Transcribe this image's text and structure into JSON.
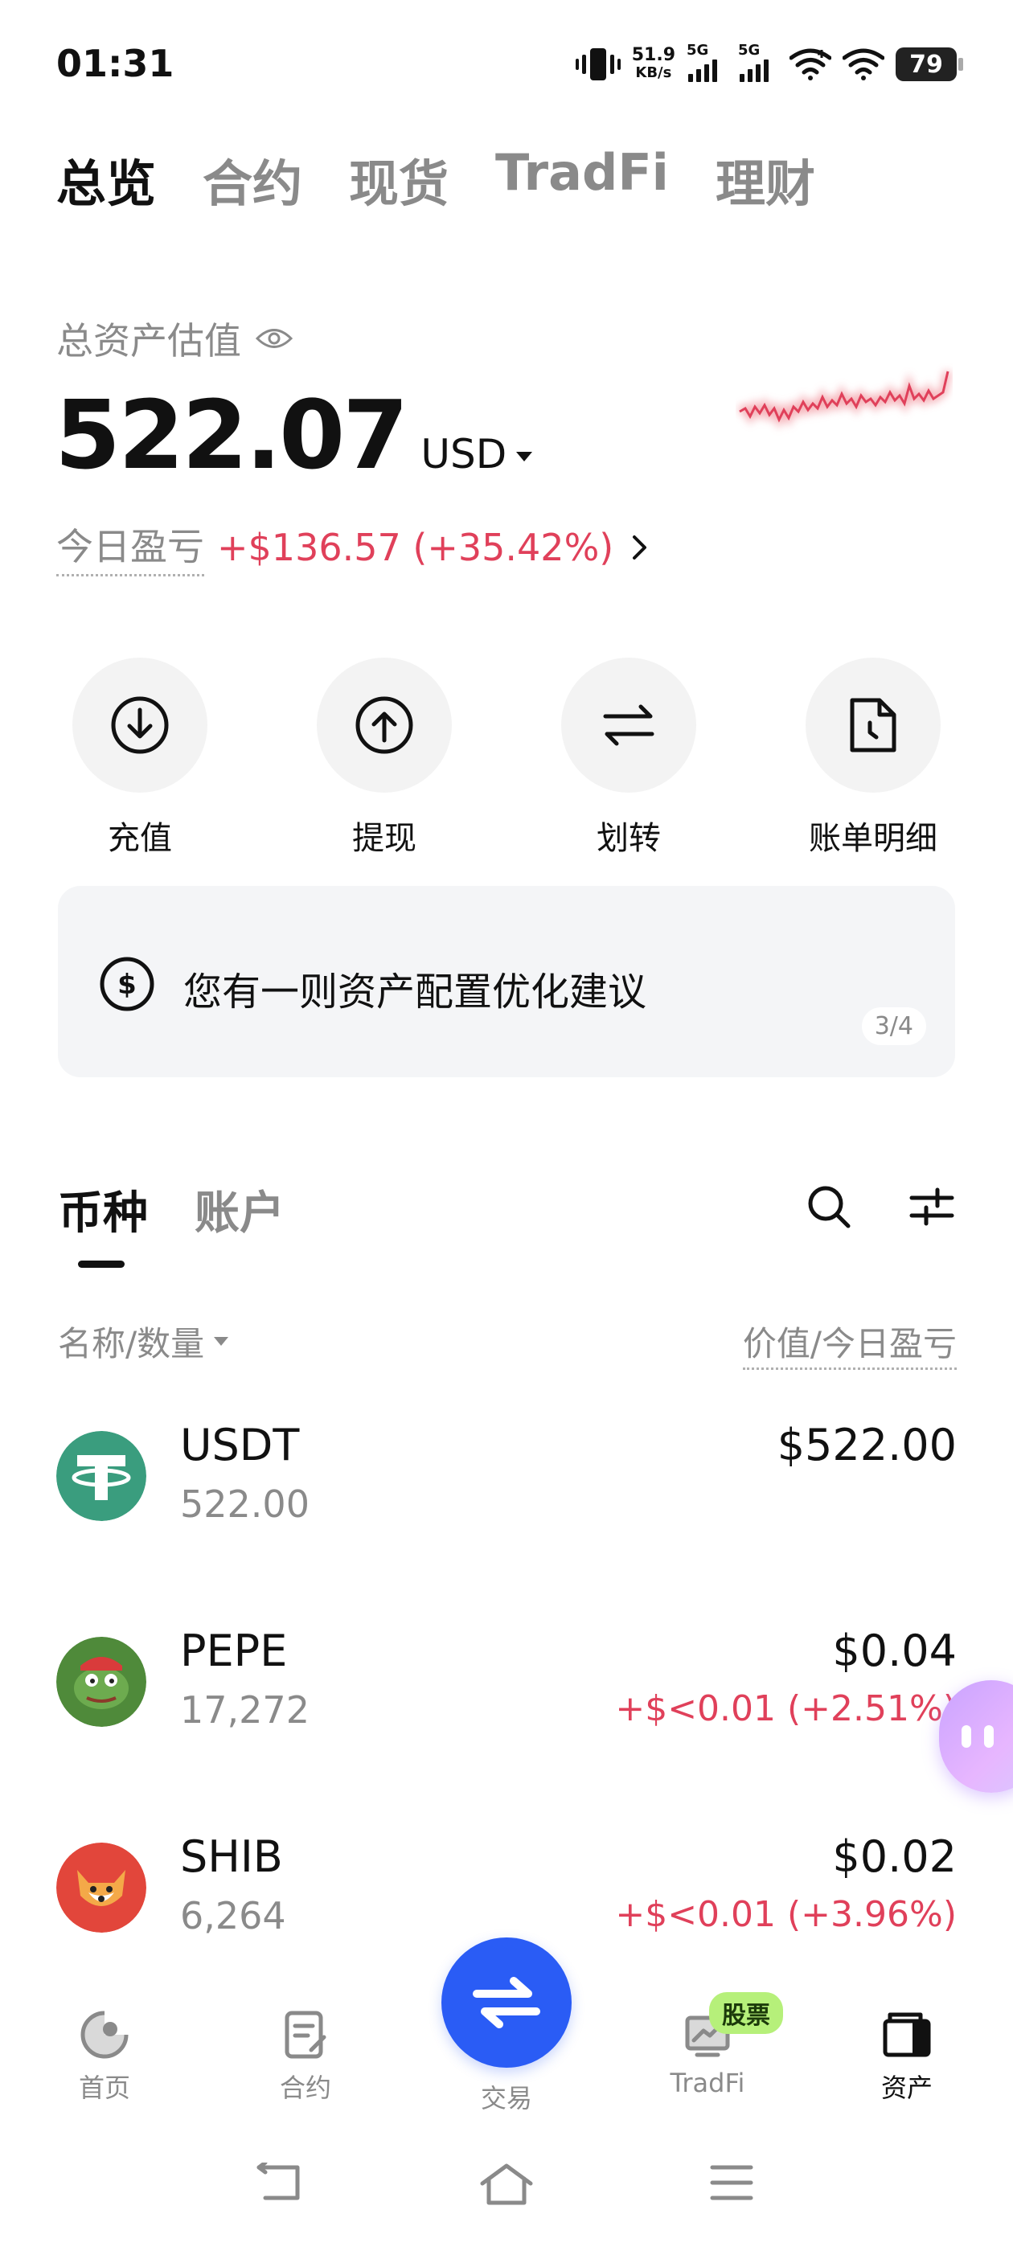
{
  "status_bar": {
    "time": "01:31",
    "net_speed_value": "51.9",
    "net_speed_unit": "KB/s",
    "sim1": "5G",
    "sim2": "5G",
    "battery": "79"
  },
  "top_tabs": [
    {
      "label": "总览",
      "active": true
    },
    {
      "label": "合约",
      "active": false
    },
    {
      "label": "现货",
      "active": false
    },
    {
      "label": "TradFi",
      "active": false
    },
    {
      "label": "理财",
      "active": false
    }
  ],
  "overview": {
    "total_label": "总资产估值",
    "total_value": "522.07",
    "currency": "USD",
    "pnl_label": "今日盈亏",
    "pnl_value": "+$136.57 (+35.42%)"
  },
  "actions": [
    {
      "label": "充值",
      "icon": "deposit-icon"
    },
    {
      "label": "提现",
      "icon": "withdraw-icon"
    },
    {
      "label": "划转",
      "icon": "transfer-icon"
    },
    {
      "label": "账单明细",
      "icon": "bill-icon"
    }
  ],
  "tip": {
    "text": "您有一则资产配置优化建议",
    "page": "3/4"
  },
  "list_tabs": [
    {
      "label": "币种",
      "active": true
    },
    {
      "label": "账户",
      "active": false
    }
  ],
  "list_header": {
    "left": "名称/数量",
    "right": "价值/今日盈亏"
  },
  "coins": [
    {
      "name": "USDT",
      "amount": "522.00",
      "value": "$522.00",
      "pnl": ""
    },
    {
      "name": "PEPE",
      "amount": "17,272",
      "value": "$0.04",
      "pnl": "+$<0.01 (+2.51%)"
    },
    {
      "name": "SHIB",
      "amount": "6,264",
      "value": "$0.02",
      "pnl": "+$<0.01 (+3.96%)"
    }
  ],
  "bottom_nav": [
    {
      "label": "首页",
      "icon": "home-icon"
    },
    {
      "label": "合约",
      "icon": "contract-icon"
    },
    {
      "label": "交易",
      "icon": "trade-icon"
    },
    {
      "label": "TradFi",
      "icon": "tradfi-icon",
      "badge": "股票"
    },
    {
      "label": "资产",
      "icon": "wallet-icon",
      "active": true
    }
  ],
  "colors": {
    "accent_blue": "#2a5cf5",
    "loss_gain_red": "#e0405a",
    "muted_text": "#8a8a8a",
    "badge_green": "#b6f07a"
  }
}
